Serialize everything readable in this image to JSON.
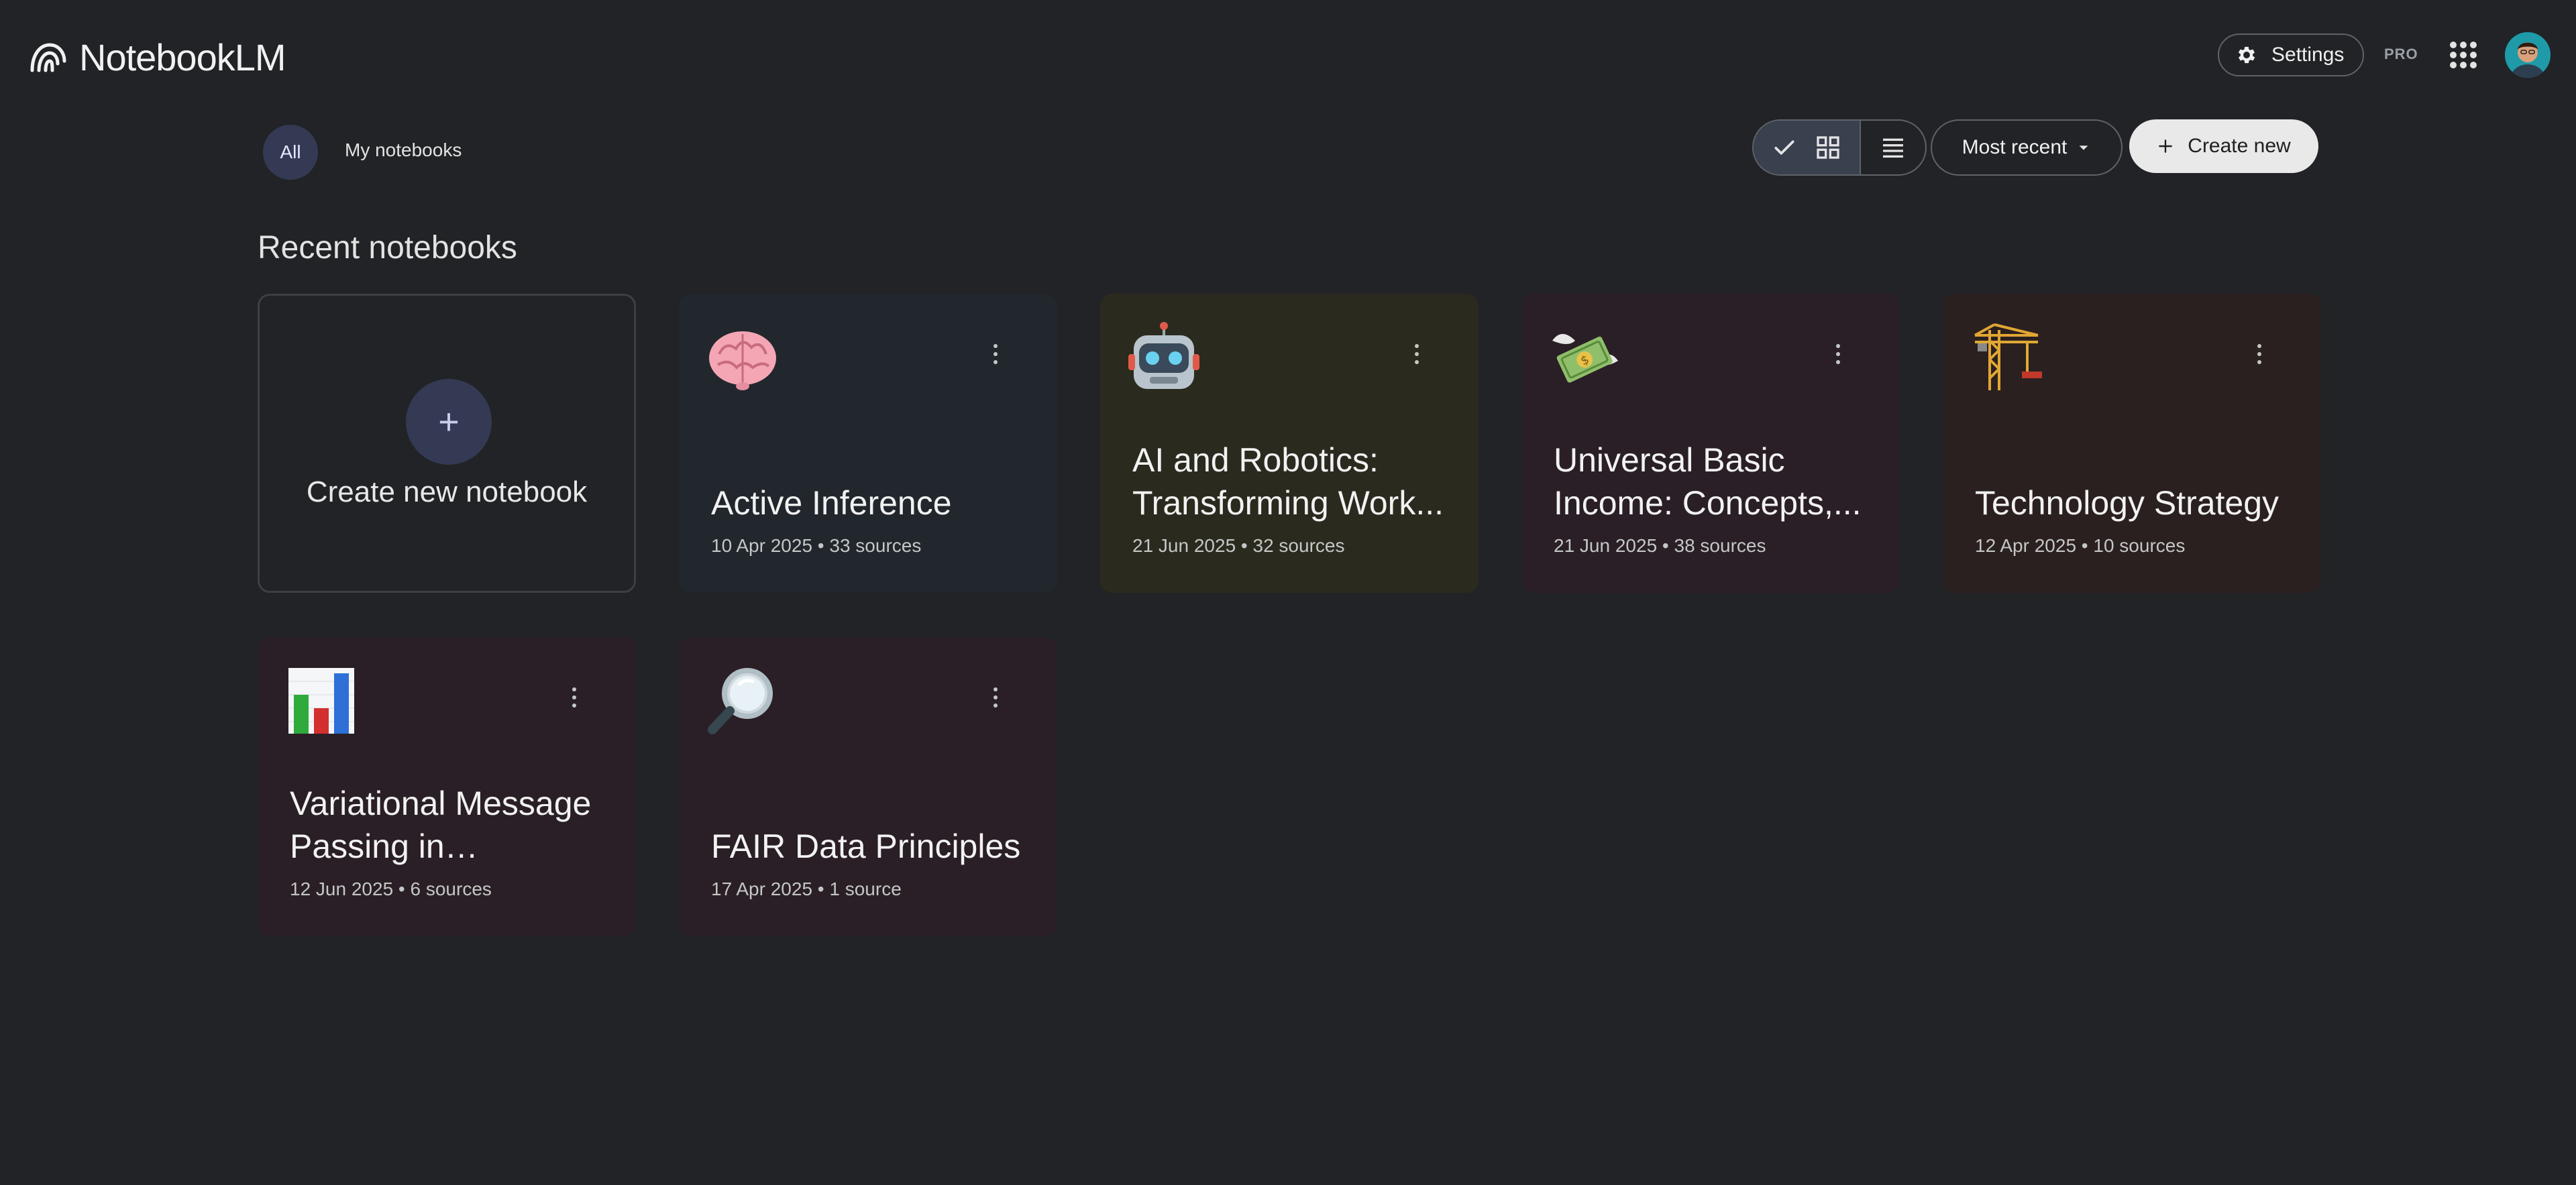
{
  "app": {
    "name": "NotebookLM"
  },
  "header": {
    "settings_label": "Settings",
    "pro_label": "PRO"
  },
  "filters": {
    "all_label": "All",
    "mine_label": "My notebooks"
  },
  "toolbar": {
    "sort_label": "Most recent",
    "create_label": "Create new"
  },
  "section": {
    "title": "Recent notebooks"
  },
  "create_card": {
    "plus": "+",
    "label": "Create new notebook"
  },
  "notebooks": [
    {
      "emoji": "brain",
      "title": "Active Inference",
      "meta": "10 Apr 2025 • 33 sources",
      "bg": "#21272d"
    },
    {
      "emoji": "robot",
      "title": "AI and Robotics: Transforming Work...",
      "meta": "21 Jun 2025 • 32 sources",
      "bg": "#2b2a1f"
    },
    {
      "emoji": "money-wings",
      "title": "Universal Basic Income: Concepts,...",
      "meta": "21 Jun 2025 • 38 sources",
      "bg": "#2a1f26"
    },
    {
      "emoji": "crane",
      "title": "Technology Strategy",
      "meta": "12 Apr 2025 • 10 sources",
      "bg": "#2b2020"
    },
    {
      "emoji": "bar-chart",
      "title": "Variational Message Passing in Bayesian...",
      "meta": "12 Jun 2025 • 6 sources",
      "bg": "#2a1f26"
    },
    {
      "emoji": "magnifier",
      "title": "FAIR Data Principles",
      "meta": "17 Apr 2025 • 1 source",
      "bg": "#2a1f26"
    }
  ]
}
